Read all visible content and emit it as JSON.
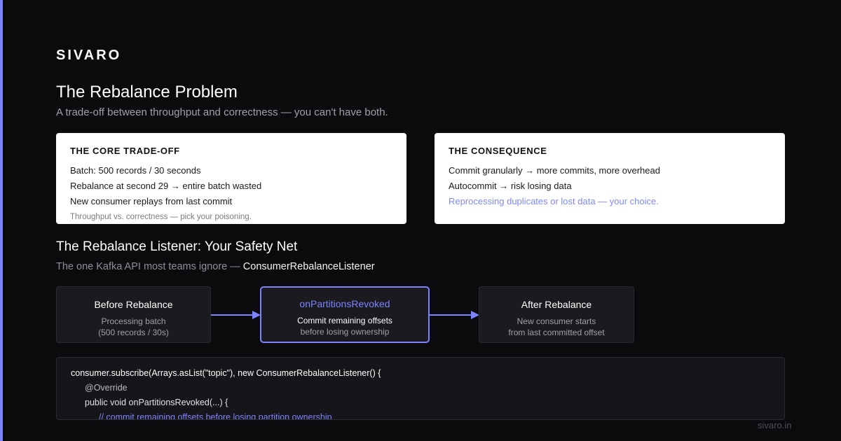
{
  "brand": "SIVARO",
  "title": "The Rebalance Problem",
  "subtitle": "A trade-off between throughput and correctness — you can't have both.",
  "colors": {
    "accent": "#7c83ff",
    "background": "#0b0b0e",
    "card": "#ffffff"
  },
  "core_tradeoff": {
    "heading": "THE CORE TRADE-OFF",
    "lines": [
      "Batch: 500 records / 30 seconds",
      "Rebalance at second 29 → entire batch wasted",
      "New consumer replays from last commit"
    ],
    "note": "Throughput vs. correctness — pick your poisoning."
  },
  "consequence": {
    "heading": "THE CONSEQUENCE",
    "lines": [
      "Commit granularly → more commits, more overhead",
      "Autocommit → risk losing data"
    ],
    "accent_line": "Reprocessing duplicates or lost data — your choice."
  },
  "listener": {
    "title": "The Rebalance Listener: Your Safety Net",
    "subtitle_prefix": "The one Kafka API most teams ignore — ",
    "subtitle_api": "ConsumerRebalanceListener"
  },
  "flow": [
    {
      "title": "Before Rebalance",
      "line1": "Processing batch",
      "line2": "(500 records / 30s)"
    },
    {
      "title": "onPartitionsRevoked",
      "line1": "Commit remaining offsets",
      "line2": "before losing ownership"
    },
    {
      "title": "After Rebalance",
      "line1": "New consumer starts",
      "line2": "from last committed offset"
    }
  ],
  "code": [
    "consumer.subscribe(Arrays.asList(\"topic\"), new ConsumerRebalanceListener() {",
    "@Override",
    "public void onPartitionsRevoked(...) {",
    "// commit remaining offsets before losing partition ownership"
  ],
  "footer_url": "sivaro.in"
}
